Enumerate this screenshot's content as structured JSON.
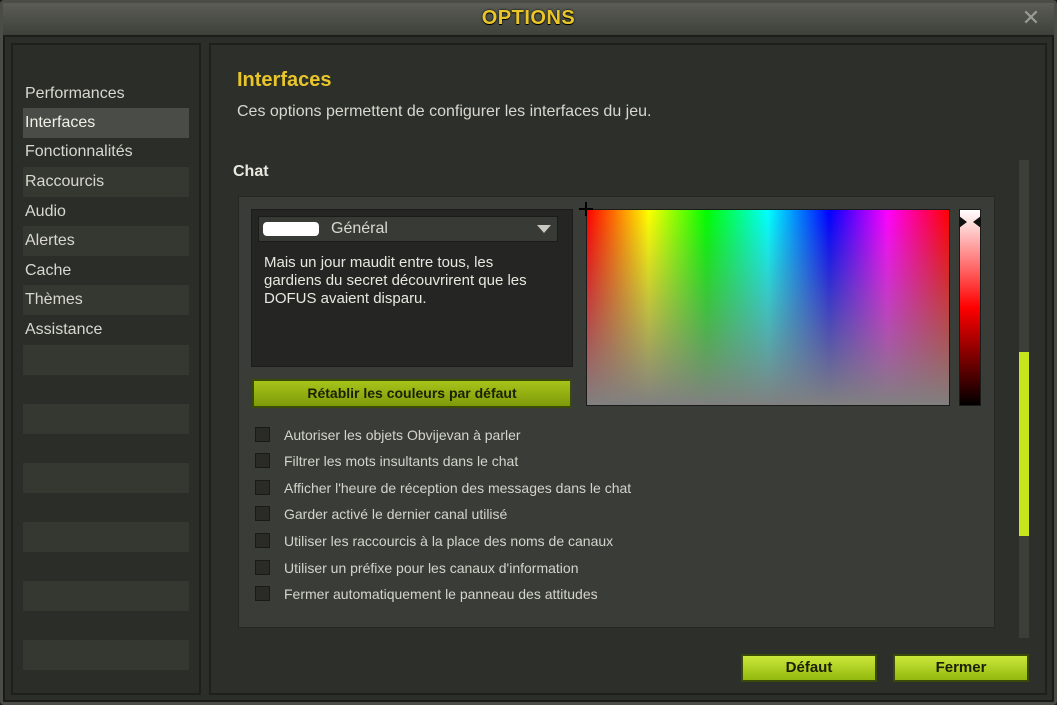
{
  "window": {
    "title": "OPTIONS",
    "close_icon": "close-x-icon"
  },
  "sidebar": {
    "items": [
      {
        "label": "Performances",
        "active": false
      },
      {
        "label": "Interfaces",
        "active": true
      },
      {
        "label": "Fonctionnalités",
        "active": false
      },
      {
        "label": "Raccourcis",
        "active": false
      },
      {
        "label": "Audio",
        "active": false
      },
      {
        "label": "Alertes",
        "active": false
      },
      {
        "label": "Cache",
        "active": false
      },
      {
        "label": "Thèmes",
        "active": false
      },
      {
        "label": "Assistance",
        "active": false
      }
    ]
  },
  "main": {
    "heading": "Interfaces",
    "description": "Ces options permettent de configurer les interfaces du jeu.",
    "section_title": "Chat",
    "channel_select": {
      "selected": "Général",
      "swatch_color": "#ffffff"
    },
    "preview_text": "Mais un jour maudit entre tous, les gardiens du secret découvrirent que les DOFUS avaient disparu.",
    "reset_colors_label": "Rétablir les couleurs par défaut",
    "options": [
      {
        "label": "Autoriser les objets Obvijevan à parler",
        "checked": false
      },
      {
        "label": "Filtrer les mots insultants dans le chat",
        "checked": false
      },
      {
        "label": "Afficher l'heure de réception des messages dans le chat",
        "checked": false
      },
      {
        "label": "Garder activé le dernier canal utilisé",
        "checked": false
      },
      {
        "label": "Utiliser les raccourcis à la place des noms de canaux",
        "checked": false
      },
      {
        "label": "Utiliser un préfixe pour les canaux d'information",
        "checked": false
      },
      {
        "label": "Fermer automatiquement le panneau des attitudes",
        "checked": false
      }
    ]
  },
  "footer": {
    "default_label": "Défaut",
    "close_label": "Fermer"
  },
  "colors": {
    "accent_yellow": "#e8c62a",
    "button_green": "#a6c41a",
    "scrollbar_thumb": "#c8e61c"
  }
}
